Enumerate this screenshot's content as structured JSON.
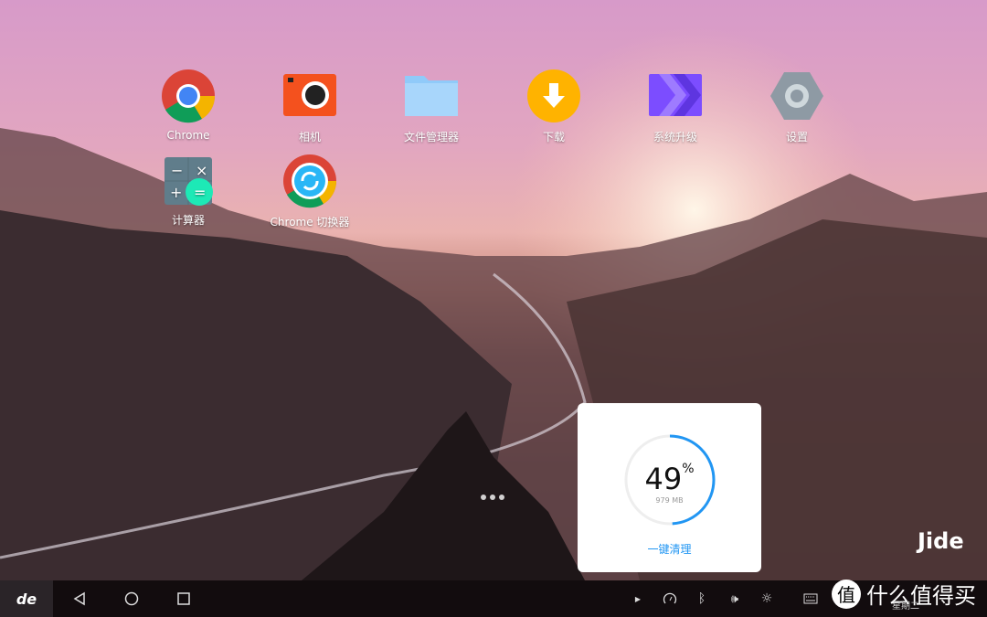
{
  "apps": [
    {
      "label": "Chrome",
      "icon": "chrome-icon"
    },
    {
      "label": "相机",
      "icon": "camera-icon"
    },
    {
      "label": "文件管理器",
      "icon": "folder-icon"
    },
    {
      "label": "下载",
      "icon": "download-icon"
    },
    {
      "label": "系统升级",
      "icon": "system-upgrade-icon"
    },
    {
      "label": "设置",
      "icon": "settings-icon"
    },
    {
      "label": "计算器",
      "icon": "calculator-icon"
    },
    {
      "label": "Chrome 切换器",
      "icon": "chrome-switcher-icon"
    }
  ],
  "memory": {
    "percent": 49,
    "percent_text": "49",
    "percent_sign": "%",
    "used": "979 MB",
    "clean_label": "一键清理",
    "accent": "#2196f3"
  },
  "brand": "Jide",
  "taskbar": {
    "logo": "de",
    "day": "星期二"
  },
  "watermark": {
    "badge": "值",
    "text": "什么值得买"
  }
}
